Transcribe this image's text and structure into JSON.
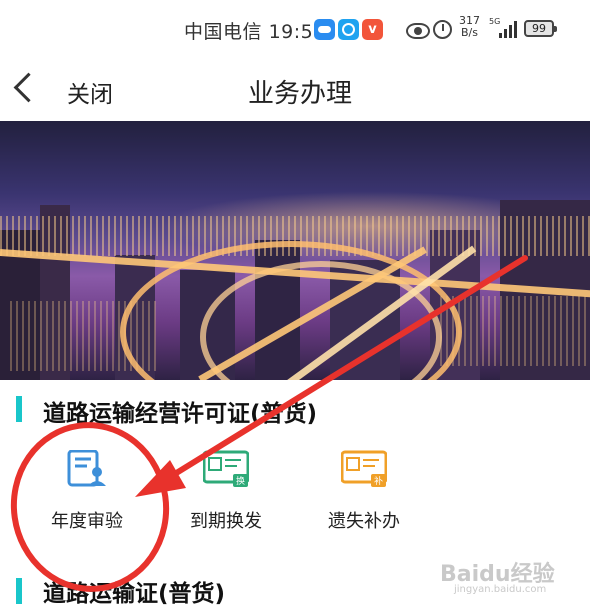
{
  "status_bar": {
    "carrier": "中国电信",
    "time": "19:57",
    "net_speed_top": "317",
    "net_speed_bottom": "B/s",
    "signal_label": "5G",
    "battery": "99",
    "icons": [
      "weather-app-icon",
      "browser-app-icon",
      "video-app-icon",
      "eye-icon",
      "alarm-icon",
      "signal-icon",
      "battery-icon"
    ]
  },
  "nav": {
    "back_icon": "chevron-left-icon",
    "close_label": "关闭",
    "title": "业务办理"
  },
  "sections": [
    {
      "title": "道路运输经营许可证(普货)",
      "items": [
        {
          "label": "年度审验",
          "icon": "document-person-icon",
          "color": "#3d8fd9"
        },
        {
          "label": "到期换发",
          "icon": "certificate-exchange-icon",
          "color": "#2eaa78"
        },
        {
          "label": "遗失补办",
          "icon": "certificate-reissue-icon",
          "color": "#f0a028"
        }
      ]
    },
    {
      "title": "道路运输证(普货)"
    }
  ],
  "watermark": {
    "main": "Baidu经验",
    "sub": "jingyan.baidu.com"
  },
  "colors": {
    "accent": "#19c6ca",
    "annotation": "#e8322c"
  }
}
